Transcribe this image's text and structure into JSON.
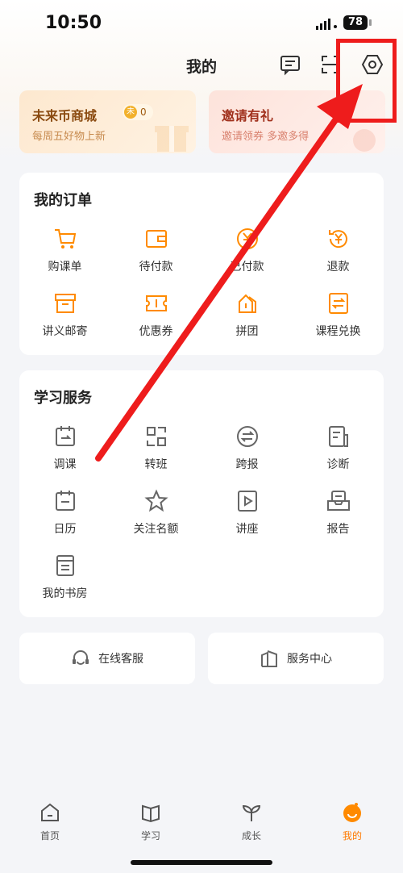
{
  "status_bar": {
    "time": "10:50",
    "battery": "78"
  },
  "header": {
    "title": "我的",
    "icons": [
      "message-icon",
      "scan-icon",
      "settings-icon"
    ]
  },
  "banners": {
    "coins": {
      "title": "未来币商城",
      "coin_count": "0",
      "coin_symbol": "未",
      "subtitle": "每周五好物上新"
    },
    "invite": {
      "title": "邀请有礼",
      "subtitle": "邀请领券 多邀多得"
    }
  },
  "orders": {
    "title": "我的订单",
    "items": [
      {
        "label": "购课单",
        "icon": "cart-icon"
      },
      {
        "label": "待付款",
        "icon": "wallet-icon"
      },
      {
        "label": "已付款",
        "icon": "yuan-circle-icon"
      },
      {
        "label": "退款",
        "icon": "refund-icon"
      },
      {
        "label": "讲义邮寄",
        "icon": "box-icon"
      },
      {
        "label": "优惠券",
        "icon": "coupon-icon"
      },
      {
        "label": "拼团",
        "icon": "group-buy-icon"
      },
      {
        "label": "课程兑换",
        "icon": "exchange-icon"
      }
    ]
  },
  "study": {
    "title": "学习服务",
    "items": [
      {
        "label": "调课",
        "icon": "calendar-switch-icon"
      },
      {
        "label": "转班",
        "icon": "transfer-icon"
      },
      {
        "label": "跨报",
        "icon": "swap-circle-icon"
      },
      {
        "label": "诊断",
        "icon": "report-doc-icon"
      },
      {
        "label": "日历",
        "icon": "calendar-icon"
      },
      {
        "label": "关注名额",
        "icon": "star-icon"
      },
      {
        "label": "讲座",
        "icon": "play-doc-icon"
      },
      {
        "label": "报告",
        "icon": "inbox-icon"
      },
      {
        "label": "我的书房",
        "icon": "bookshelf-icon"
      }
    ]
  },
  "services": {
    "online": {
      "label": "在线客服",
      "icon": "headset-icon"
    },
    "center": {
      "label": "服务中心",
      "icon": "building-icon"
    }
  },
  "bottom_nav": [
    {
      "label": "首页",
      "icon": "home-icon"
    },
    {
      "label": "学习",
      "icon": "book-icon"
    },
    {
      "label": "成长",
      "icon": "sprout-icon"
    },
    {
      "label": "我的",
      "icon": "profile-icon",
      "active": true
    }
  ],
  "colors": {
    "accent": "#ff8a00",
    "annotation": "#ee1c1c",
    "icon_gray": "#666666"
  }
}
